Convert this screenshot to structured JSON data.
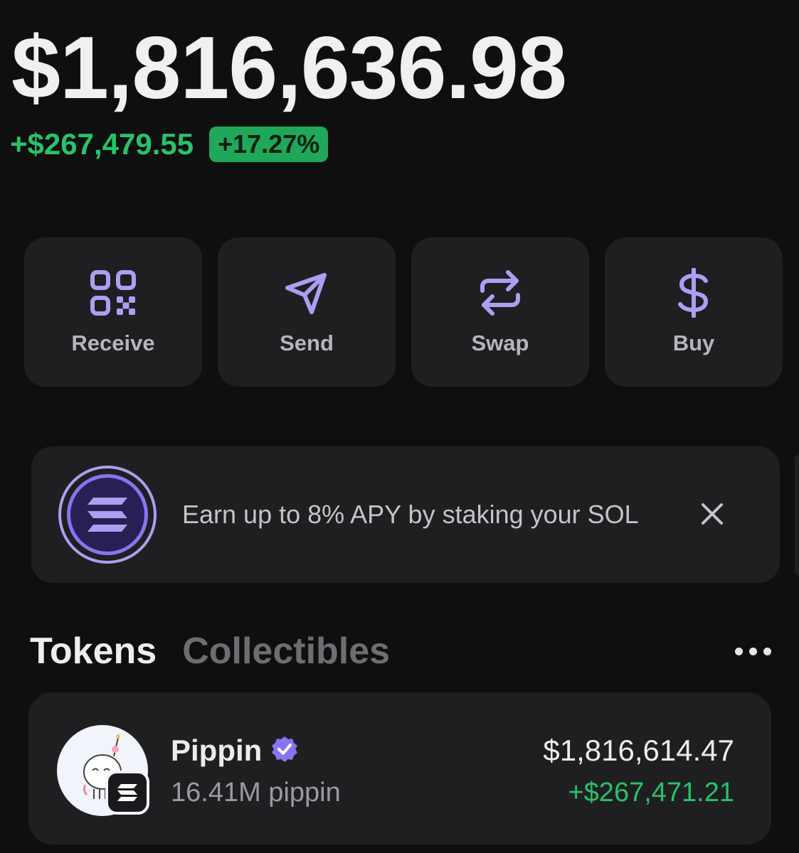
{
  "balance": {
    "total": "$1,816,636.98",
    "change_amount": "+$267,479.55",
    "change_percent": "+17.27%"
  },
  "colors": {
    "accent": "#ab9ff2",
    "positive": "#27c36a",
    "card_bg": "#1f1f21",
    "page_bg": "#0f0f10"
  },
  "actions": [
    {
      "label": "Receive",
      "icon": "qr-code-icon"
    },
    {
      "label": "Send",
      "icon": "send-arrow-icon"
    },
    {
      "label": "Swap",
      "icon": "swap-arrows-icon"
    },
    {
      "label": "Buy",
      "icon": "dollar-sign-icon"
    }
  ],
  "promo": {
    "text": "Earn up to 8% APY by staking your SOL",
    "icon": "solana-logo-icon",
    "close_icon": "close-icon"
  },
  "tabs": [
    {
      "label": "Tokens",
      "active": true
    },
    {
      "label": "Collectibles",
      "active": false
    }
  ],
  "tokens": [
    {
      "name": "Pippin",
      "verified": true,
      "amount": "16.41M pippin",
      "value": "$1,816,614.47",
      "change": "+$267,471.21"
    }
  ]
}
